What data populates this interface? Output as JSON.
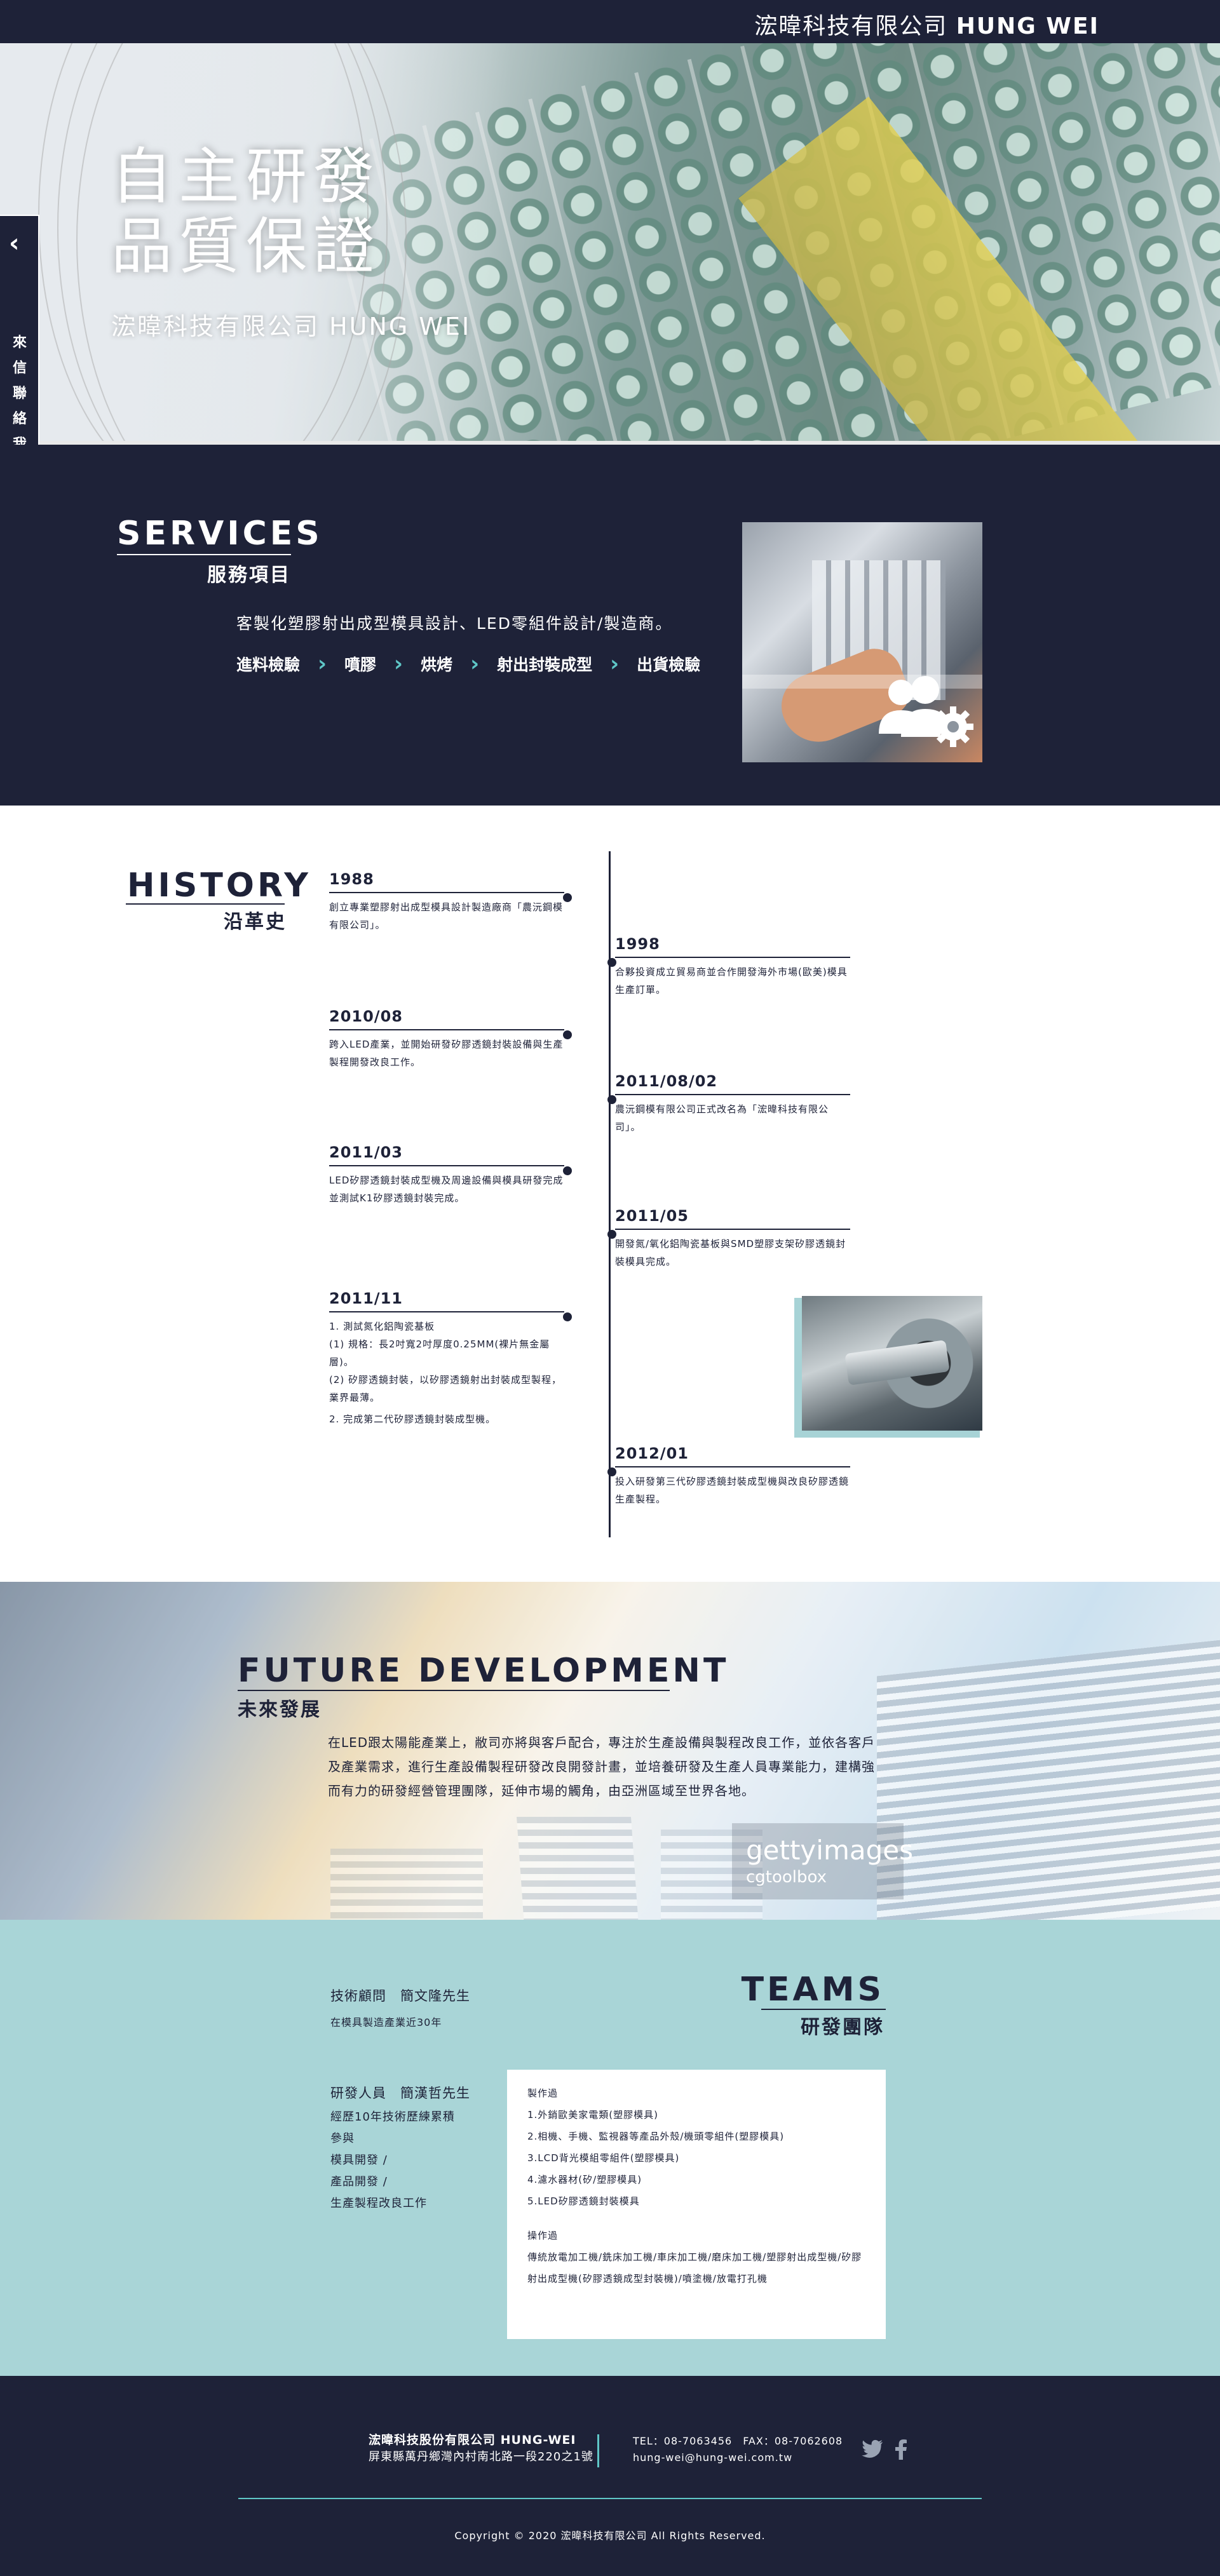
{
  "header": {
    "brand_zh": "浤暐科技有限公司",
    "brand_en": "HUNG WEI"
  },
  "hero": {
    "line1": "自主研發",
    "line2": "品質保證",
    "subtitle": "浤暐科技有限公司 HUNG WEI"
  },
  "sidetab": {
    "chevron": "‹",
    "label": "來信聯絡我們"
  },
  "services": {
    "title_en": "SERVICES",
    "title_zh": "服務項目",
    "desc": "客製化塑膠射出成型模具設計、LED零組件設計/製造商。",
    "steps": [
      "進料檢驗",
      "噴膠",
      "烘烤",
      "射出封裝成型",
      "出貨檢驗"
    ],
    "icon": "users-gear-icon"
  },
  "history": {
    "title_en": "HISTORY",
    "title_zh": "沿革史",
    "events": [
      {
        "year": "1988",
        "text": "創立專業塑膠射出成型模具設計製造廠商「農沅鋼模有限公司」。"
      },
      {
        "year": "1998",
        "text": "合夥投資成立貿易商並合作開發海外市場(歐美)模具生產訂單。"
      },
      {
        "year": "2010/08",
        "text": "跨入LED產業，並開始研發矽膠透鏡封裝設備與生產製程開發改良工作。"
      },
      {
        "year": "2011/08/02",
        "text": "農沅鋼模有限公司正式改名為「浤暐科技有限公司」。"
      },
      {
        "year": "2011/03",
        "text": "LED矽膠透鏡封裝成型機及周邊設備與模具研發完成並測試K1矽膠透鏡封裝完成。"
      },
      {
        "year": "2011/05",
        "text": "開發氮/氧化鋁陶瓷基板與SMD塑膠支架矽膠透鏡封裝模具完成。"
      },
      {
        "year": "2011/11",
        "lines": [
          "1. 測試氮化鋁陶瓷基板",
          "(1) 規格：長2吋寬2吋厚度0.25MM(裸片無金屬層)。",
          "(2) 矽膠透鏡封裝，以矽膠透鏡射出封裝成型製程，業界最薄。",
          "2. 完成第二代矽膠透鏡封裝成型機。"
        ]
      },
      {
        "year": "2012/01",
        "text": "投入研發第三代矽膠透鏡封裝成型機與改良矽膠透鏡生產製程。"
      }
    ]
  },
  "future": {
    "title_en": "FUTURE DEVELOPMENT",
    "title_zh": "未來發展",
    "text": "在LED跟太陽能產業上，敝司亦將與客戶配合，專注於生產設備與製程改良工作，並依各客戶及產業需求，進行生產設備製程研發改良開發計畫，並培養研發及生產人員專業能力，建構強而有力的研發經營管理團隊，延伸市場的觸角，由亞洲區域至世界各地。",
    "watermark_1": "gettyimages",
    "watermark_2": "cgtoolbox"
  },
  "teams": {
    "title_en": "TEAMS",
    "title_zh": "研發團隊",
    "advisor": "技術顧問　簡文隆先生",
    "advisor_sub": "在模具製造產業近30年",
    "researcher": "研發人員　簡漢哲先生",
    "researcher_lines": [
      "經歷10年技術歷練累積",
      "參與",
      "模具開發 /",
      "產品開發 /",
      "生產製程改良工作"
    ],
    "card_head1": "製作過",
    "card_list": [
      "1.外銷歐美家電類(塑膠模具)",
      "2.相機、手機、監視器等產品外殼/機頭零組件(塑膠模具)",
      "3.LCD背光模組零組件(塑膠模具)",
      "4.濾水器材(矽/塑膠模具)",
      "5.LED矽膠透鏡封裝模具"
    ],
    "card_head2": "操作過",
    "card_ops": "傳統放電加工機/銑床加工機/車床加工機/磨床加工機/塑膠射出成型機/矽膠射出成型機(矽膠透鏡成型封裝機)/噴塗機/放電打孔機"
  },
  "footer": {
    "company": "浤暐科技股份有限公司 HUNG-WEI",
    "address": "屏東縣萬丹鄉灣內村南北路一段220之1號",
    "tel_fax": "TEL：08-7063456　FAX：08-7062608",
    "email": "hung-wei@hung-wei.com.tw",
    "copyright": "Copyright © 2020 浤暐科技有限公司 All Rights Reserved.",
    "social": [
      "twitter-icon",
      "facebook-icon"
    ]
  }
}
